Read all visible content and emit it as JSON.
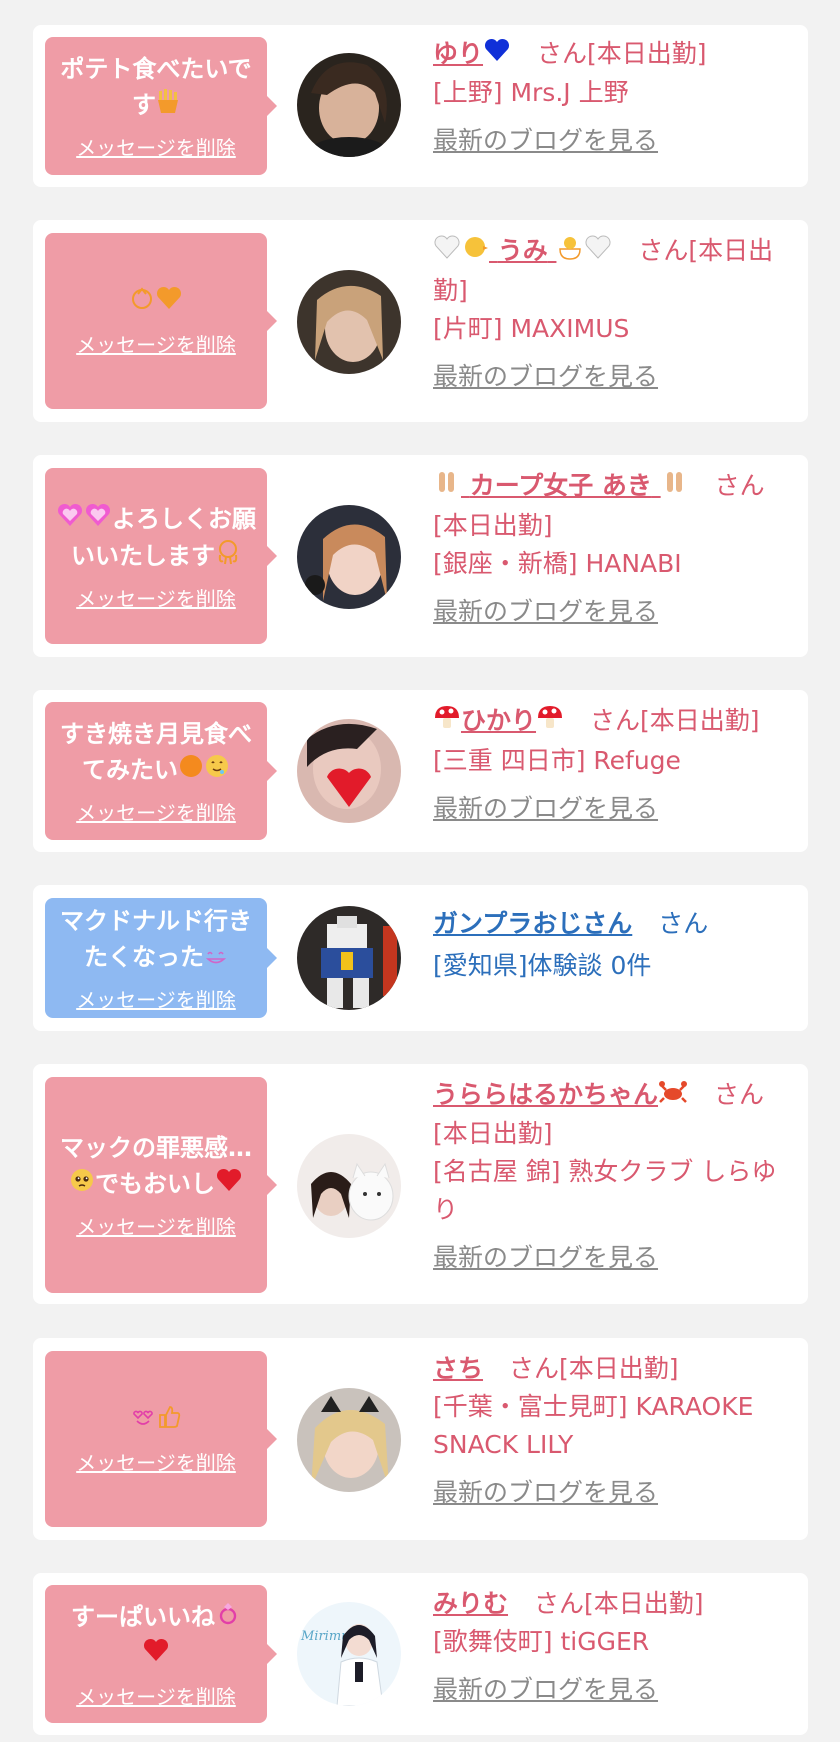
{
  "delete_label": "メッセージを削除",
  "blog_label": "最新のブログを見る",
  "colors": {
    "background": "#f2f2f2",
    "card": "#ffffff",
    "bubble_pink": "#ef9ca6",
    "bubble_blue": "#8eb9f2",
    "name_pink": "#d9596f",
    "name_blue": "#2c6fbb",
    "blog_gray": "#8a8a8a"
  },
  "items": [
    {
      "message_text": "ポテト食べたいです",
      "message_icons": [
        "fries-icon"
      ],
      "name": "ゆり",
      "name_icons_after": [
        "blue-heart-icon"
      ],
      "suffix": "さん[本日出勤]",
      "shop": "[上野] Mrs.J 上野",
      "has_blog": true
    },
    {
      "message_text": "",
      "message_icons": [
        "chick-icon",
        "orange-heart-icon"
      ],
      "name": "うみ",
      "name_icons_before": [
        "white-heart-icon",
        "chick-icon"
      ],
      "name_icons_after": [
        "chick-icon",
        "white-heart-icon"
      ],
      "suffix": "さん[本日出勤]",
      "shop": "[片町] MAXIMUS",
      "has_blog": true
    },
    {
      "message_text": "よろしくお願いいたします",
      "message_icons_before": [
        "pink-heart-icon",
        "pink-heart-icon"
      ],
      "message_icons": [
        "octopus-icon"
      ],
      "name": "カープ女子 あき",
      "name_icons_before": [
        "hands-icon"
      ],
      "name_icons_after": [
        "hands-icon"
      ],
      "suffix": "さん[本日出勤]",
      "shop": "[銀座・新橋] HANABI",
      "has_blog": true
    },
    {
      "message_text": "すき焼き月見食べてみたい",
      "message_icons": [
        "orange-circle-icon",
        "drooling-face-icon"
      ],
      "name": "ひかり",
      "name_icons_before": [
        "mushroom-icon"
      ],
      "name_icons_after": [
        "mushroom-icon"
      ],
      "suffix": "さん[本日出勤]",
      "shop": "[三重 四日市] Refuge",
      "has_blog": true
    },
    {
      "message_text": "マクドナルド行きたくなった",
      "message_icons": [
        "smile-face-icon"
      ],
      "name": "ガンプラおじさん",
      "suffix": "さん",
      "shop": "[愛知県]体験談 0件",
      "has_blog": false
    },
    {
      "message_text": "マックの罪悪感…でもおいし",
      "message_icons_mid": [
        "pleading-face-icon"
      ],
      "message_icons": [
        "red-heart-icon"
      ],
      "name": "うららはるかちゃん",
      "name_icons_after": [
        "crab-icon"
      ],
      "suffix": "さん[本日出勤]",
      "shop": "[名古屋 錦] 熟女クラブ しらゆり",
      "has_blog": true
    },
    {
      "message_text": "",
      "message_icons": [
        "heart-eyes-icon",
        "thumbs-up-icon"
      ],
      "name": "さち",
      "suffix": "さん[本日出勤]",
      "shop": "[千葉・富士見町] KARAOKE SNACK LILY",
      "has_blog": true
    },
    {
      "message_text": "すーぱいいね",
      "message_icons": [
        "ring-icon",
        "red-heart-icon"
      ],
      "name": "みりむ",
      "suffix": "さん[本日出勤]",
      "shop": "[歌舞伎町] tiGGER",
      "has_blog": true,
      "avatar_text": "Mirimu"
    }
  ]
}
